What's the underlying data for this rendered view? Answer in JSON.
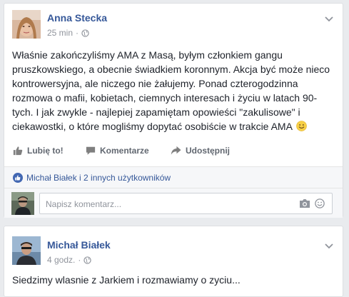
{
  "posts": [
    {
      "author": "Anna Stecka",
      "time": "25 min",
      "separator": "·",
      "privacy_icon": "globe-icon",
      "menu_icon": "chevron-down-icon",
      "text": "Właśnie zakończyliśmy AMA z Masą, byłym członkiem gangu pruszkowskiego, a obecnie świadkiem koronnym. Akcja być może nieco kontrowersyjna, ale niczego nie żałujemy. Ponad czterogodzinna rozmowa o mafii, kobietach, ciemnych interesach i życiu w latach 90-tych. I jak zwykle - najlepiej zapamiętam opowieści \"zakulisowe\" i ciekawostki, o które mogliśmy dopytać osobiście w trakcie AMA",
      "emoji": "smile-emoji",
      "actions": {
        "like": "Lubię to!",
        "comment": "Komentarze",
        "share": "Udostępnij"
      },
      "likers": "Michał Białek i 2 innych użytkowników",
      "comment_placeholder": "Napisz komentarz..."
    },
    {
      "author": "Michał Białek",
      "time": "4 godz.",
      "separator": "·",
      "privacy_icon": "globe-icon",
      "menu_icon": "chevron-down-icon",
      "text": "Siedzimy wlasnie z Jarkiem i rozmawiamy o zyciu..."
    }
  ],
  "colors": {
    "link": "#365899",
    "text": "#1d2129",
    "muted": "#90949c",
    "action": "#616770",
    "background": "#e9ebee",
    "like_blue": "#4267b2"
  }
}
